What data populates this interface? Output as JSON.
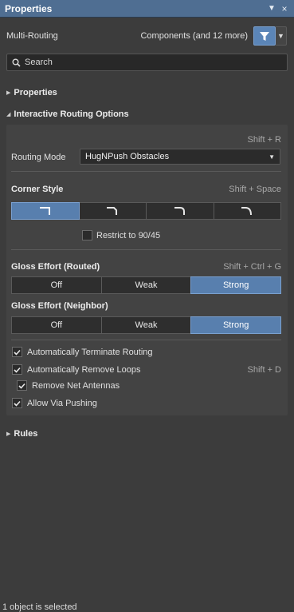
{
  "panel": {
    "title": "Properties",
    "menu_glyph": "▼",
    "close_glyph": "×"
  },
  "header": {
    "mode": "Multi-Routing",
    "filter_text": "Components (and 12 more)",
    "filter_icon": "filter-icon",
    "dropdown_glyph": "▼"
  },
  "search": {
    "placeholder": "Search"
  },
  "sections": {
    "properties": "Properties",
    "interactive": "Interactive Routing Options",
    "rules": "Rules"
  },
  "routing": {
    "shortcut": "Shift + R",
    "mode_label": "Routing Mode",
    "mode_value": "HugNPush Obstacles"
  },
  "corner": {
    "label": "Corner Style",
    "shortcut": "Shift + Space",
    "styles": [
      "corner-90-icon",
      "corner-45-icon",
      "corner-arc-90-icon",
      "corner-arc-45-icon"
    ],
    "selected_index": 0,
    "restrict_label": "Restrict to 90/45",
    "restrict_checked": false
  },
  "gloss_routed": {
    "label": "Gloss Effort (Routed)",
    "shortcut": "Shift + Ctrl + G",
    "options": [
      "Off",
      "Weak",
      "Strong"
    ],
    "selected": "Strong"
  },
  "gloss_neighbor": {
    "label": "Gloss Effort (Neighbor)",
    "options": [
      "Off",
      "Weak",
      "Strong"
    ],
    "selected": "Strong"
  },
  "options": {
    "auto_terminate": "Automatically Terminate Routing",
    "auto_remove_loops": "Automatically Remove Loops",
    "auto_remove_loops_shortcut": "Shift + D",
    "remove_net_antennas": "Remove Net Antennas",
    "allow_via_pushing": "Allow Via Pushing"
  },
  "status": "1 object is selected",
  "colors": {
    "accent": "#587fae",
    "titlebar": "#4f6e92",
    "background": "#3c3c3c"
  }
}
